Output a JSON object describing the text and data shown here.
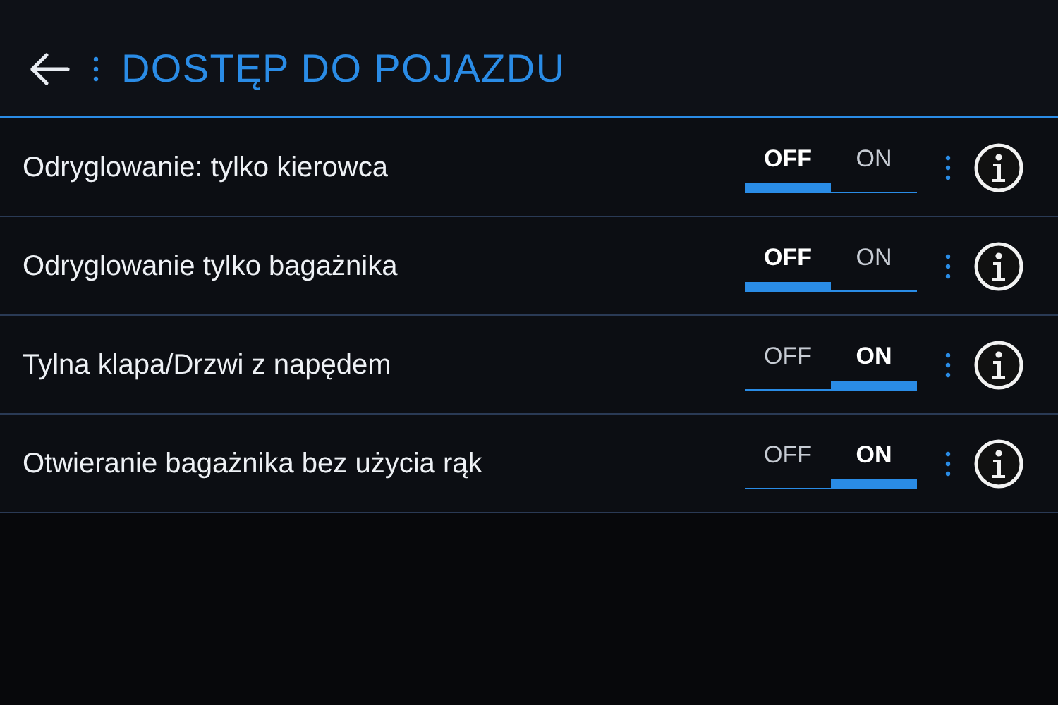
{
  "header": {
    "title": "DOSTĘP DO POJAZDU"
  },
  "rows": [
    {
      "label": "Odryglowanie: tylko kierowca",
      "off_label": "OFF",
      "on_label": "ON",
      "on": false
    },
    {
      "label": "Odryglowanie tylko bagażnika",
      "off_label": "OFF",
      "on_label": "ON",
      "on": false
    },
    {
      "label": "Tylna klapa/Drzwi z napędem",
      "off_label": "OFF",
      "on_label": "ON",
      "on": true
    },
    {
      "label": "Otwieranie bagażnika bez użycia rąk",
      "off_label": "OFF",
      "on_label": "ON",
      "on": true
    }
  ]
}
